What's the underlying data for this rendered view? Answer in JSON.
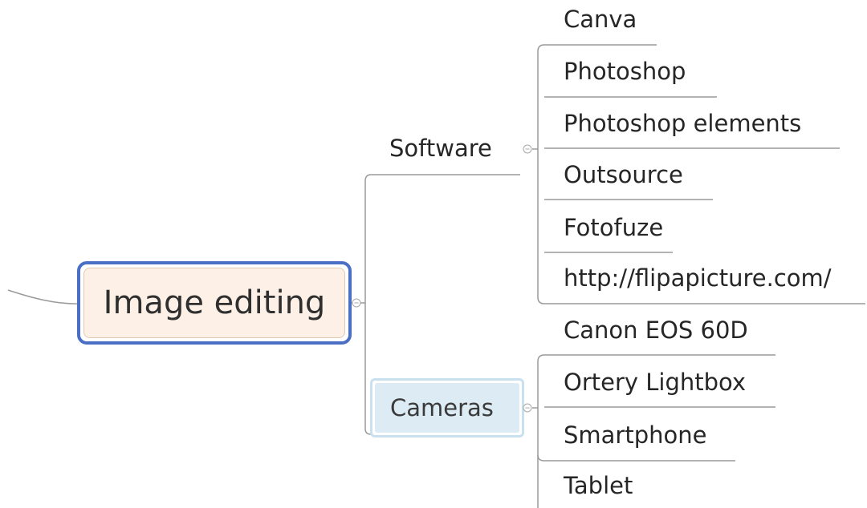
{
  "root": {
    "label": "Image editing"
  },
  "branches": [
    {
      "label": "Software",
      "children": [
        "Canva",
        "Photoshop",
        "Photoshop elements",
        "Outsource",
        "Fotofuze",
        "http://flipapicture.com/"
      ]
    },
    {
      "label": "Cameras",
      "children": [
        "Canon EOS 60D",
        "Ortery Lightbox",
        "Smartphone",
        "Tablet"
      ]
    }
  ],
  "colors": {
    "root_border": "#4a6fc4",
    "root_fill": "#fdf0e6",
    "cameras_fill": "#dcebf4",
    "connector": "#9a9a9a",
    "text": "#262626"
  },
  "icons": {
    "collapse": "minus-circle-icon"
  }
}
